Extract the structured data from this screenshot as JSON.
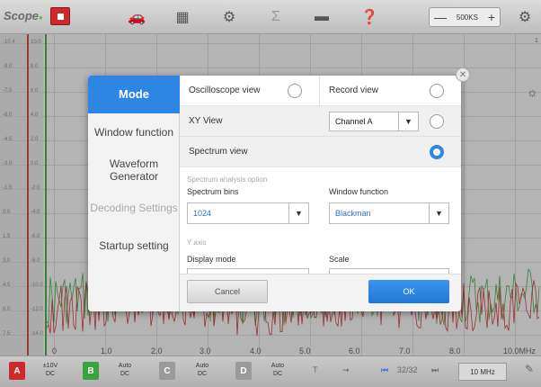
{
  "toolbar": {
    "logo": "Scope",
    "sample_rate": "500KS",
    "minus": "—",
    "plus": "+"
  },
  "plot": {
    "y_ticks_left": [
      "-10.4",
      "-9.0",
      "-7.5",
      "-6.0",
      "-4.5",
      "-3.0",
      "-1.5",
      "0.0",
      "1.5",
      "3.0",
      "4.5",
      "6.0",
      "7.5"
    ],
    "y_ticks_right": [
      "10.0",
      "8.0",
      "6.0",
      "4.0",
      "2.0",
      "0.0",
      "-2.0",
      "-4.0",
      "-6.0",
      "-8.0",
      "-10.0",
      "-12.0",
      "-14.0"
    ],
    "x_ticks": [
      "0",
      "1.0",
      "2.0",
      "3.0",
      "4.0",
      "5.0",
      "6.0",
      "7.0",
      "8.0",
      "10.0MHz"
    ],
    "top_corner": "1"
  },
  "dialog": {
    "nav": [
      {
        "label": "Mode",
        "state": "active"
      },
      {
        "label": "Window function",
        "state": "normal"
      },
      {
        "label": "Waveform Generator",
        "state": "normal"
      },
      {
        "label": "Decoding Settings",
        "state": "disabled"
      },
      {
        "label": "Startup setting",
        "state": "normal"
      }
    ],
    "oscilloscope_view": "Oscilloscope view",
    "record_view": "Record view",
    "xy_view": "XY View",
    "xy_channel": "Channel A",
    "spectrum_view": "Spectrum view",
    "spectrum_option": "Spectrum analysis option",
    "spectrum_bins_label": "Spectrum bins",
    "spectrum_bins_value": "1024",
    "window_function_label": "Window function",
    "window_function_value": "Blackman",
    "y_axis_label": "Y axis",
    "display_mode_label": "Display mode",
    "scale_label": "Scale",
    "cancel": "Cancel",
    "ok": "OK"
  },
  "bottom": {
    "ch_a": "A",
    "ch_a_range": "±10V",
    "ch_a_coupling": "DC",
    "ch_b": "B",
    "ch_b_range": "Auto",
    "ch_b_coupling": "DC",
    "ch_c": "C",
    "ch_c_range": "Auto",
    "ch_c_coupling": "DC",
    "ch_d": "D",
    "ch_d_range": "Auto",
    "ch_d_coupling": "DC",
    "page": "32/32",
    "bandwidth": "10 MHz"
  },
  "colors": {
    "accent": "#2d86e4",
    "channel_a": "#cc2a2a",
    "channel_b": "#3da13d",
    "stop": "#cc2a2a"
  }
}
